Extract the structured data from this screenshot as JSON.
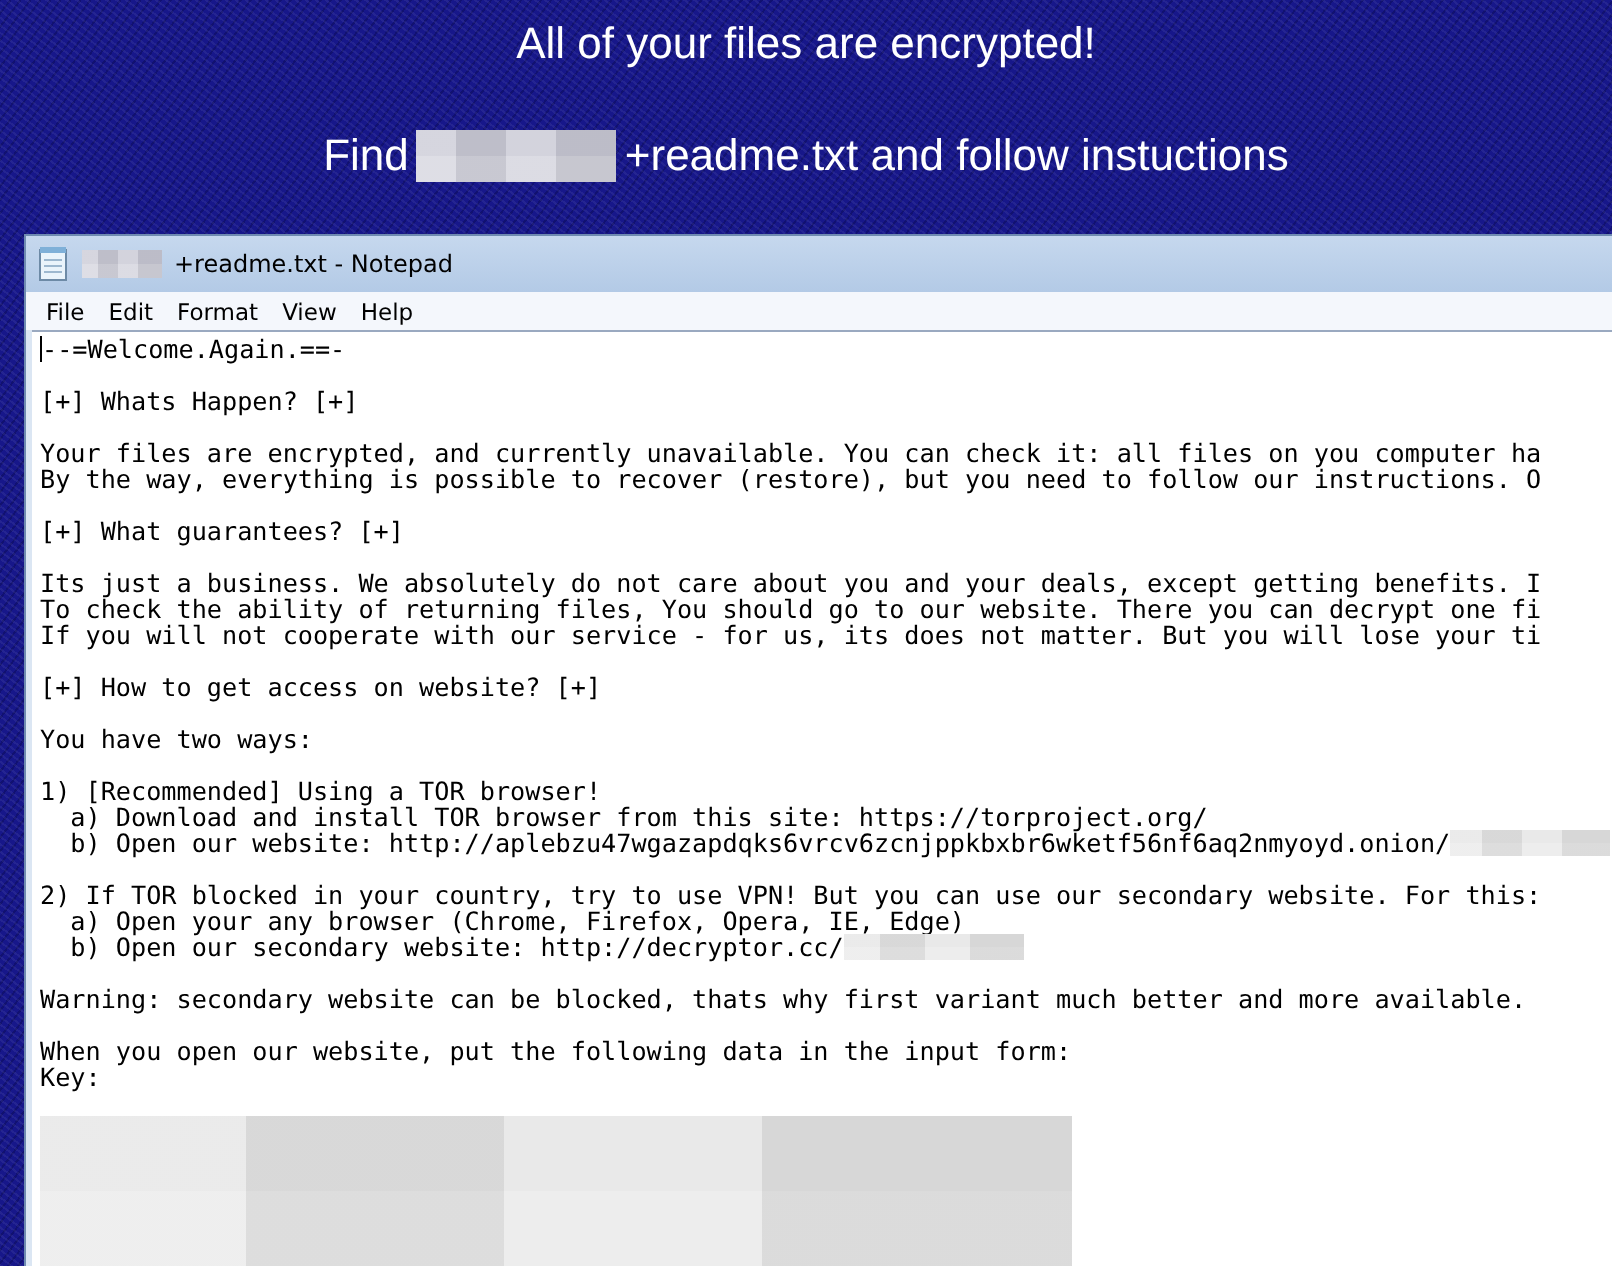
{
  "banner": {
    "headline": "All of your files are encrypted!",
    "instruction": [
      {
        "kind": "text",
        "text": "Find"
      },
      {
        "kind": "redacted"
      },
      {
        "kind": "text",
        "text": "+readme.txt and follow instuctions"
      }
    ]
  },
  "window": {
    "title_redacted": true,
    "title": "+readme.txt - Notepad"
  },
  "menu": [
    "File",
    "Edit",
    "Format",
    "View",
    "Help"
  ],
  "lines": [
    {
      "kind": "text",
      "text": "--=Welcome.Again.==-",
      "caret": true
    },
    {
      "kind": "blank"
    },
    {
      "kind": "text",
      "text": "[+] Whats Happen? [+]"
    },
    {
      "kind": "blank"
    },
    {
      "kind": "text",
      "text": "Your files are encrypted, and currently unavailable. You can check it: all files on you computer ha"
    },
    {
      "kind": "text",
      "text": "By the way, everything is possible to recover (restore), but you need to follow our instructions. O"
    },
    {
      "kind": "blank"
    },
    {
      "kind": "text",
      "text": "[+] What guarantees? [+]"
    },
    {
      "kind": "blank"
    },
    {
      "kind": "text",
      "text": "Its just a business. We absolutely do not care about you and your deals, except getting benefits. I"
    },
    {
      "kind": "text",
      "text": "To check the ability of returning files, You should go to our website. There you can decrypt one fi"
    },
    {
      "kind": "text",
      "text": "If you will not cooperate with our service - for us, its does not matter. But you will lose your ti"
    },
    {
      "kind": "blank"
    },
    {
      "kind": "text",
      "text": "[+] How to get access on website? [+]"
    },
    {
      "kind": "blank"
    },
    {
      "kind": "text",
      "text": "You have two ways:"
    },
    {
      "kind": "blank"
    },
    {
      "kind": "text",
      "text": "1) [Recommended] Using a TOR browser!"
    },
    {
      "kind": "text",
      "text": "  a) Download and install TOR browser from this site: https://torproject.org/"
    },
    {
      "kind": "text",
      "text": "  b) Open our website: http://aplebzu47wgazapdqks6vrcv6zcnjppkbxbr6wketf56nf6aq2nmyoyd.onion/",
      "redacted": true
    },
    {
      "kind": "blank"
    },
    {
      "kind": "text",
      "text": "2) If TOR blocked in your country, try to use VPN! But you can use our secondary website. For this:"
    },
    {
      "kind": "text",
      "text": "  a) Open your any browser (Chrome, Firefox, Opera, IE, Edge)"
    },
    {
      "kind": "text",
      "text": "  b) Open our secondary website: http://decryptor.cc/",
      "redacted": true
    },
    {
      "kind": "blank"
    },
    {
      "kind": "text",
      "text": "Warning: secondary website can be blocked, thats why first variant much better and more available."
    },
    {
      "kind": "blank"
    },
    {
      "kind": "text",
      "text": "When you open our website, put the following data in the input form:"
    },
    {
      "kind": "text",
      "text": "Key:"
    },
    {
      "kind": "blank"
    },
    {
      "kind": "redacted_block"
    }
  ]
}
